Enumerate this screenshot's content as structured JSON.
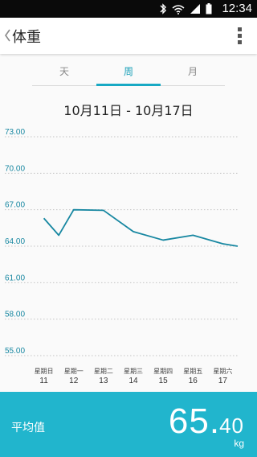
{
  "status_bar": {
    "time": "12:34",
    "icons": [
      "bluetooth-icon",
      "wifi-icon",
      "signal-icon",
      "battery-icon"
    ]
  },
  "app_bar": {
    "title": "体重",
    "back_icon": "chevron-left-icon",
    "menu_icon": "overflow-menu-icon"
  },
  "tabs": [
    {
      "label": "天",
      "active": false
    },
    {
      "label": "周",
      "active": true
    },
    {
      "label": "月",
      "active": false
    }
  ],
  "date_range": "10月11日 - 10月17日",
  "chart_data": {
    "type": "line",
    "categories": [
      "星期日",
      "星期一",
      "星期二",
      "星期三",
      "星期四",
      "星期五",
      "星期六"
    ],
    "dates": [
      "11",
      "12",
      "13",
      "14",
      "15",
      "16",
      "17"
    ],
    "x": [
      11,
      11.5,
      12,
      13,
      14,
      15,
      16,
      17,
      17.5
    ],
    "values": [
      66.3,
      64.9,
      67.0,
      66.95,
      65.2,
      64.5,
      64.9,
      64.2,
      64.0
    ],
    "y_ticks": [
      "73.00",
      "70.00",
      "67.00",
      "64.00",
      "61.00",
      "58.00",
      "55.00"
    ],
    "ylim": [
      55,
      73
    ],
    "grid": true,
    "line_color": "#1787a1"
  },
  "summary": {
    "label": "平均值",
    "value_int": "65",
    "value_dec": "40",
    "unit": "kg",
    "background": "#21b5cd"
  }
}
